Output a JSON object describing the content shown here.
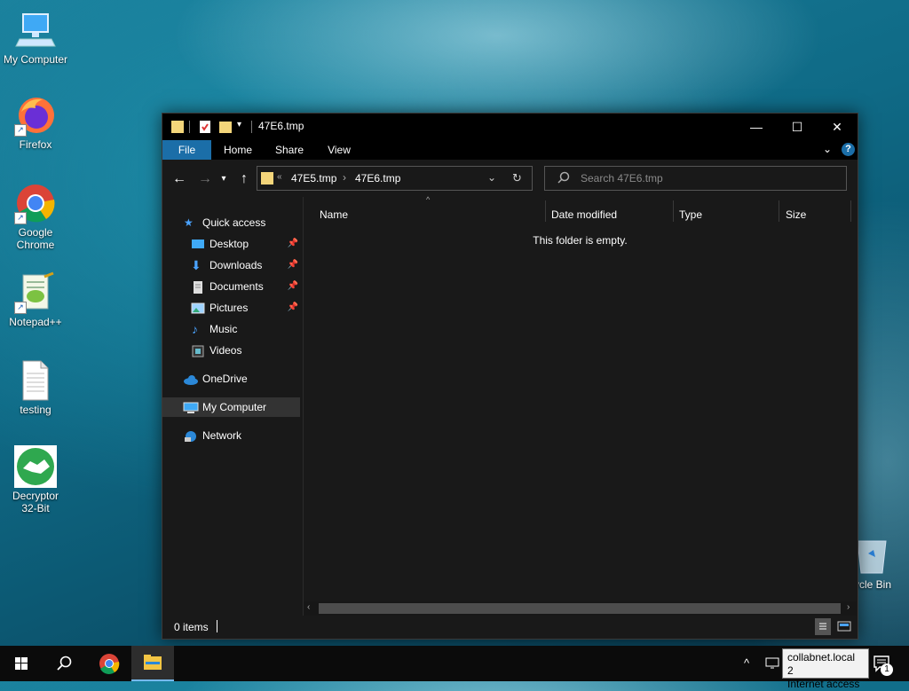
{
  "desktop": {
    "icons": [
      {
        "label": "My Computer"
      },
      {
        "label": "Firefox"
      },
      {
        "label": "Google Chrome"
      },
      {
        "label": "Notepad++"
      },
      {
        "label": "testing"
      },
      {
        "label": "Decryptor 32-Bit"
      },
      {
        "label": "ycle Bin"
      }
    ]
  },
  "window": {
    "title": "47E6.tmp",
    "controls": {
      "minimize": "—",
      "maximize": "☐",
      "close": "✕"
    },
    "ribbon_tabs": [
      "File",
      "Home",
      "Share",
      "View"
    ],
    "help_label": "?",
    "address": {
      "overflow": "«",
      "crumbs": [
        "47E5.tmp",
        "47E6.tmp"
      ],
      "separator": "›"
    },
    "search_placeholder": "Search 47E6.tmp",
    "sidebar": {
      "quick_access": "Quick access",
      "items": [
        {
          "label": "Desktop",
          "pinned": true
        },
        {
          "label": "Downloads",
          "pinned": true
        },
        {
          "label": "Documents",
          "pinned": true
        },
        {
          "label": "Pictures",
          "pinned": true
        },
        {
          "label": "Music",
          "pinned": false
        },
        {
          "label": "Videos",
          "pinned": false
        }
      ],
      "onedrive": "OneDrive",
      "my_computer": "My Computer",
      "network": "Network"
    },
    "columns": [
      "Name",
      "Date modified",
      "Type",
      "Size"
    ],
    "empty_message": "This folder is empty.",
    "status_items": "0 items"
  },
  "taskbar": {
    "tooltip_line1": "collabnet.local 2",
    "tooltip_line2": "Internet access",
    "notification_count": "1"
  },
  "colors": {
    "accent": "#1b6ea8",
    "window_bg": "#191919",
    "titlebar": "#000000"
  }
}
